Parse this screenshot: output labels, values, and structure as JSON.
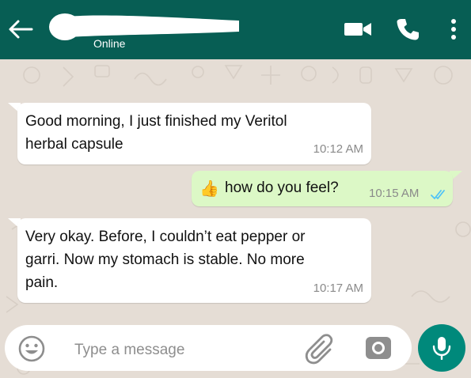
{
  "header": {
    "status": "Online",
    "colors": {
      "bar": "#075e54",
      "icons": "#ffffff"
    },
    "icons": [
      "back-arrow-icon",
      "video-call-icon",
      "voice-call-icon",
      "more-options-icon"
    ]
  },
  "messages": [
    {
      "direction": "incoming",
      "lines": [
        "Good morning, I just finished my Veritol",
        "herbal capsule"
      ],
      "time": "10:12 AM"
    },
    {
      "direction": "outgoing",
      "emoji": "👍",
      "text": "how do you feel?",
      "time": "10:15 AM",
      "receipt": "read-double-tick"
    },
    {
      "direction": "incoming",
      "lines": [
        "Very okay. Before, I couldn’t eat pepper or",
        "garri. Now my stomach is stable. No more",
        "pain."
      ],
      "time": "10:17 AM"
    }
  ],
  "composer": {
    "placeholder": "Type a message",
    "icons": [
      "emoji-icon",
      "attach-icon",
      "camera-icon",
      "mic-icon"
    ],
    "colors": {
      "mic_button": "#00897b"
    }
  },
  "colors": {
    "chat_bg": "#e5ddd5",
    "incoming_bubble": "#ffffff",
    "outgoing_bubble": "#dcf8c6",
    "read_tick": "#4fc3f7"
  }
}
